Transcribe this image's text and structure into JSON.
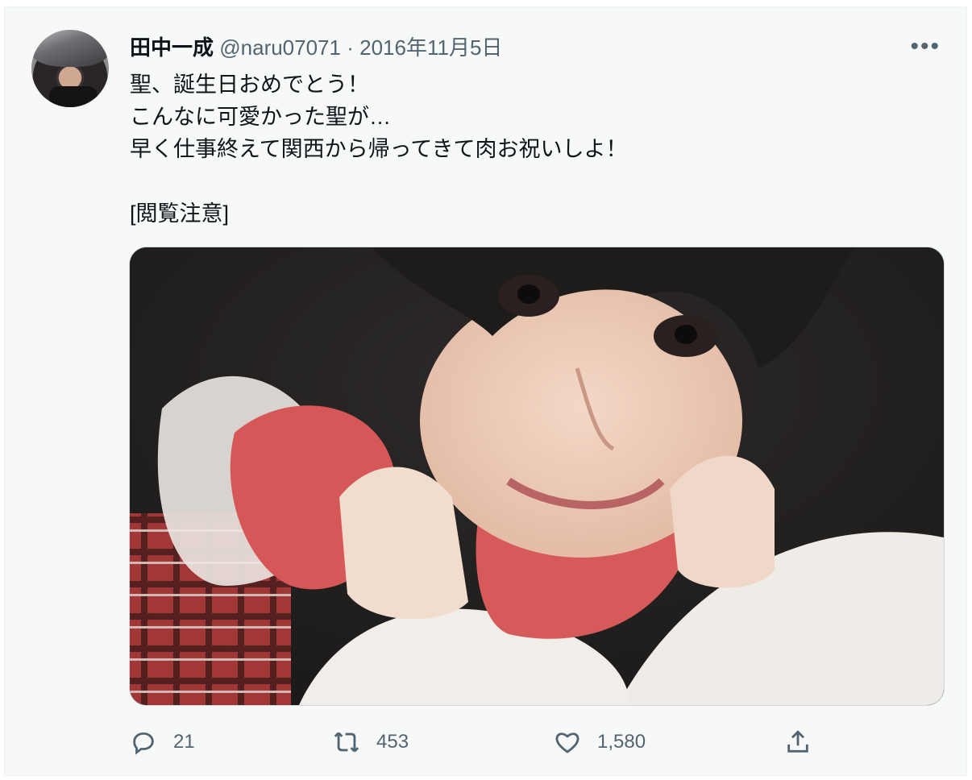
{
  "tweet": {
    "author": {
      "display_name": "田中一成",
      "handle": "@naru07071",
      "separator": "·",
      "date": "2016年11月5日"
    },
    "more_icon": "ellipsis-icon",
    "more_label": "•••",
    "text_lines": [
      "聖、誕生日おめでとう！",
      "こんなに可愛かった聖が…",
      "早く仕事終えて関西から帰ってきて肉お祝いしよ！",
      "[閲覧注意]"
    ],
    "actions": {
      "reply": {
        "icon": "reply-icon",
        "count": "21"
      },
      "retweet": {
        "icon": "retweet-icon",
        "count": "453"
      },
      "like": {
        "icon": "heart-icon",
        "count": "1,580"
      },
      "share": {
        "icon": "share-icon"
      }
    }
  },
  "colors": {
    "card_bg": "#f7f9f9",
    "text": "#0f1419",
    "secondary": "#536471"
  }
}
